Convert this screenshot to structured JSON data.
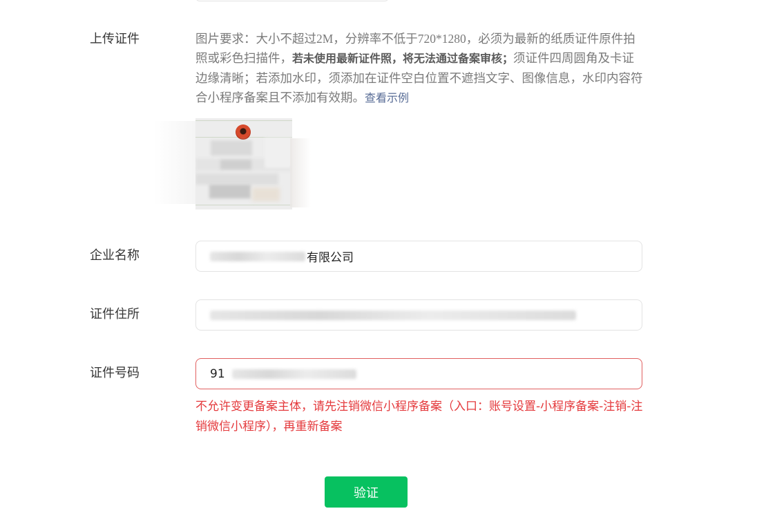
{
  "form": {
    "upload": {
      "label": "上传证件",
      "hint_part1": "图片要求：大小不超过2M，分辨率不低于720*1280，必须为最新的纸质证件原件拍照或彩色扫描件，",
      "hint_bold": "若未使用最新证件照，将无法通过备案审核；",
      "hint_part2": "须证件四周圆角及卡证边缘清晰；若添加水印，须添加在证件空白位置不遮挡文字、图像信息，水印内容符合小程序备案且不添加有效期。",
      "example_link": "查看示例"
    },
    "company_name": {
      "label": "企业名称",
      "value_suffix": "有限公司"
    },
    "address": {
      "label": "证件住所"
    },
    "license_no": {
      "label": "证件号码",
      "value_prefix": "91",
      "error": "不允许变更备案主体，请先注销微信小程序备案（入口：账号设置-小程序备案-注销-注销微信小程序），再重新备案"
    },
    "verify_button": "验证"
  },
  "colors": {
    "primary": "#07c160",
    "error": "#e4393c",
    "link": "#576b95"
  }
}
